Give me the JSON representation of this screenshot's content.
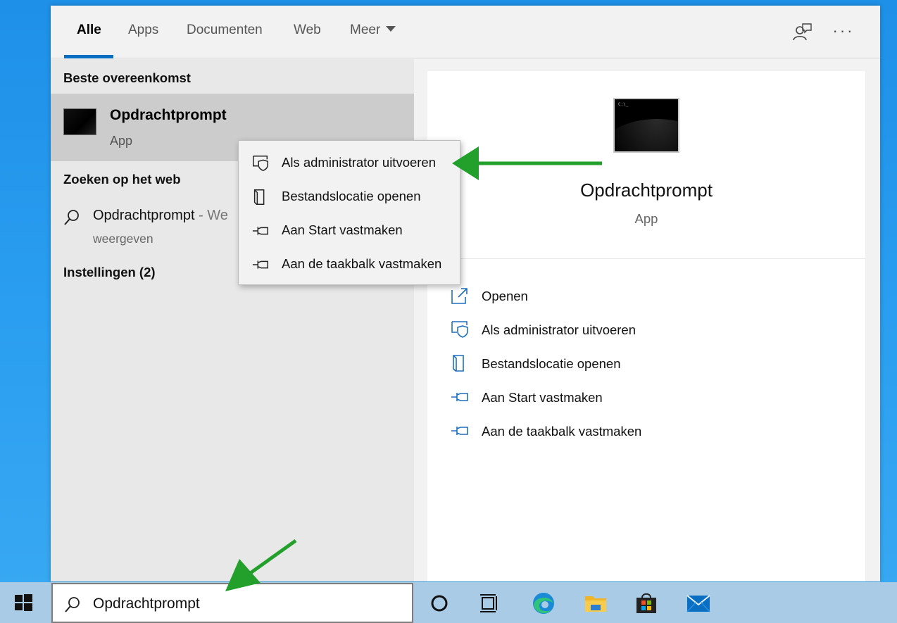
{
  "tabs": [
    {
      "label": "Alle",
      "active": true
    },
    {
      "label": "Apps",
      "active": false
    },
    {
      "label": "Documenten",
      "active": false
    },
    {
      "label": "Web",
      "active": false
    },
    {
      "label": "Meer",
      "active": false
    }
  ],
  "top_icons": [
    "feedback-icon",
    "more-options-icon"
  ],
  "more_dots": "···",
  "left": {
    "best_match_heading": "Beste overeenkomst",
    "best_match": {
      "title": "Opdrachtprompt",
      "subtitle": "App",
      "icon": "command-prompt-icon"
    },
    "web_heading": "Zoeken op het web",
    "web_result": {
      "title": "Opdrachtprompt",
      "suffix": " - We",
      "subtitle": "weergeven",
      "icon": "search-icon"
    },
    "settings_heading": "Instellingen (2)"
  },
  "context_menu": [
    {
      "label": "Als administrator uitvoeren",
      "icon": "shield-run-icon"
    },
    {
      "label": "Bestandslocatie openen",
      "icon": "folder-location-icon"
    },
    {
      "label": "Aan Start vastmaken",
      "icon": "pin-icon"
    },
    {
      "label": "Aan de taakbalk vastmaken",
      "icon": "pin-icon"
    }
  ],
  "preview": {
    "title": "Opdrachtprompt",
    "subtitle": "App",
    "icon_prompt_text": "C:\\_",
    "actions": [
      {
        "label": "Openen",
        "icon": "open-icon"
      },
      {
        "label": "Als administrator uitvoeren",
        "icon": "shield-run-icon"
      },
      {
        "label": "Bestandslocatie openen",
        "icon": "folder-location-icon"
      },
      {
        "label": "Aan Start vastmaken",
        "icon": "pin-icon"
      },
      {
        "label": "Aan de taakbalk vastmaken",
        "icon": "pin-icon"
      }
    ]
  },
  "taskbar": {
    "search_value": "Opdrachtprompt",
    "icons": [
      "windows-start-icon",
      "cortana-icon",
      "task-view-icon",
      "edge-icon",
      "file-explorer-icon",
      "store-icon",
      "mail-icon"
    ]
  },
  "colors": {
    "accent": "#0a6fc2",
    "link_blue": "#1e6fbf",
    "annotation_green": "#22a02b",
    "desktop": "#2a9ef0",
    "taskbar": "#a9cbe6"
  }
}
